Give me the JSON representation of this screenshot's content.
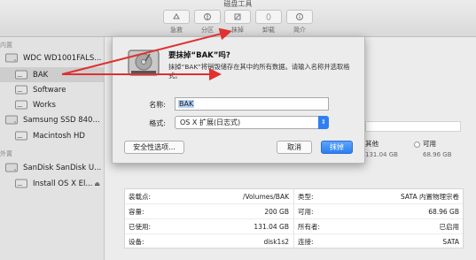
{
  "window": {
    "title": "磁盘工具"
  },
  "toolbar": {
    "buttons": [
      {
        "label": "急救",
        "icon": "first-aid-icon"
      },
      {
        "label": "分区",
        "icon": "partition-icon"
      },
      {
        "label": "抹掉",
        "icon": "erase-icon"
      },
      {
        "label": "卸载",
        "icon": "unmount-icon"
      },
      {
        "label": "简介",
        "icon": "info-icon"
      }
    ]
  },
  "sidebar": {
    "internal_header": "内置",
    "external_header": "外置",
    "items": [
      {
        "label": "WDC WD1001FALS...",
        "kind": "disk"
      },
      {
        "label": "BAK",
        "kind": "volume",
        "selected": true
      },
      {
        "label": "Software",
        "kind": "volume"
      },
      {
        "label": "Works",
        "kind": "volume"
      },
      {
        "label": "Samsung SSD 840...",
        "kind": "disk"
      },
      {
        "label": "Macintosh HD",
        "kind": "volume"
      },
      {
        "label": "SanDisk SanDisk U...",
        "kind": "disk"
      },
      {
        "label": "Install OS X El...",
        "kind": "volume",
        "eject": "⏏"
      }
    ]
  },
  "dialog": {
    "title": "要抹掉“BAK”吗?",
    "message": "抹掉“BAK”将销毁储存在其中的所有数据。请输入名称并选取格式。",
    "name_label": "名称:",
    "name_value": "BAK",
    "format_label": "格式:",
    "format_value": "OS X 扩展(日志式)",
    "security_button": "安全性选项...",
    "cancel_button": "取消",
    "erase_button": "抹掉"
  },
  "usage": {
    "other_label": "其他",
    "other_value": "131.04 GB",
    "available_label": "可用",
    "available_value": "68.96 GB"
  },
  "info": {
    "left": [
      {
        "k": "装载点:",
        "v": "/Volumes/BAK"
      },
      {
        "k": "容量:",
        "v": "200 GB"
      },
      {
        "k": "已使用:",
        "v": "131.04 GB"
      },
      {
        "k": "设备:",
        "v": "disk1s2"
      }
    ],
    "right": [
      {
        "k": "类型:",
        "v": "SATA 内置物理宗卷"
      },
      {
        "k": "可用:",
        "v": "68.96 GB"
      },
      {
        "k": "所有者:",
        "v": "已启用"
      },
      {
        "k": "连接:",
        "v": "SATA"
      }
    ]
  },
  "colors": {
    "accent": "#2b7ff2",
    "annotation": "#e03030"
  }
}
